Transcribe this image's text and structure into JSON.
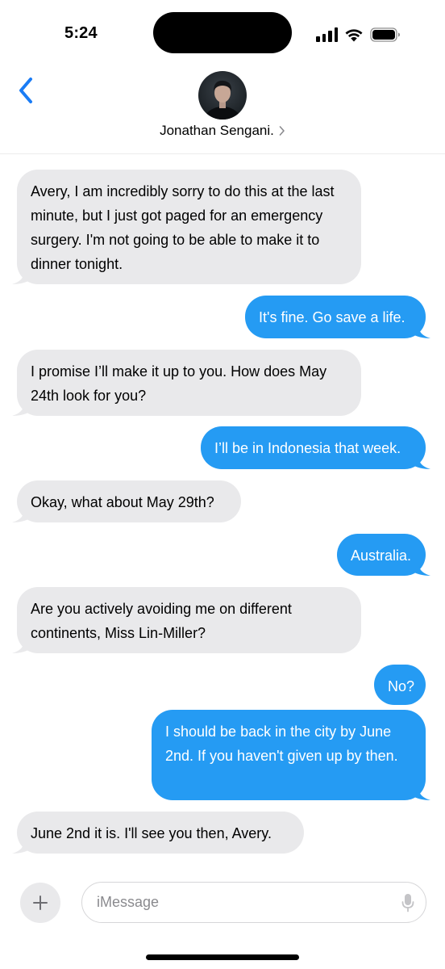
{
  "status_bar": {
    "time": "5:24",
    "icons": [
      "signal-icon",
      "wifi-icon",
      "battery-icon"
    ]
  },
  "header": {
    "contact_name": "Jonathan Sengani.",
    "back_icon": "chevron-left-icon",
    "accent_color": "#1a7cf5"
  },
  "messages": [
    {
      "from": "contact",
      "text": "Avery, I am incredibly sorry to do this at the last minute, but I just got paged for an emergency surgery. I'm not going to be able to make it to dinner tonight."
    },
    {
      "from": "me",
      "text": "It's fine. Go save a life."
    },
    {
      "from": "contact",
      "text": "I promise I’ll make it up to you. How does May 24th look for you?"
    },
    {
      "from": "me",
      "text": "I’ll be in Indonesia that week."
    },
    {
      "from": "contact",
      "text": "Okay, what about May 29th?"
    },
    {
      "from": "me",
      "text": "Australia."
    },
    {
      "from": "contact",
      "text": "Are you actively avoiding me on different continents, Miss Lin-Miller?"
    },
    {
      "from": "me",
      "text": "No?"
    },
    {
      "from": "me",
      "text": "I should be back in the city by June 2nd. If you haven't given up by then."
    },
    {
      "from": "contact",
      "text": "June 2nd it is. I'll see you then, Avery."
    }
  ],
  "colors": {
    "incoming_bubble": "#e9e9eb",
    "outgoing_bubble": "#259bf3"
  },
  "composer": {
    "placeholder": "iMessage",
    "value": "",
    "plus_icon": "plus-icon",
    "mic_icon": "mic-icon"
  }
}
